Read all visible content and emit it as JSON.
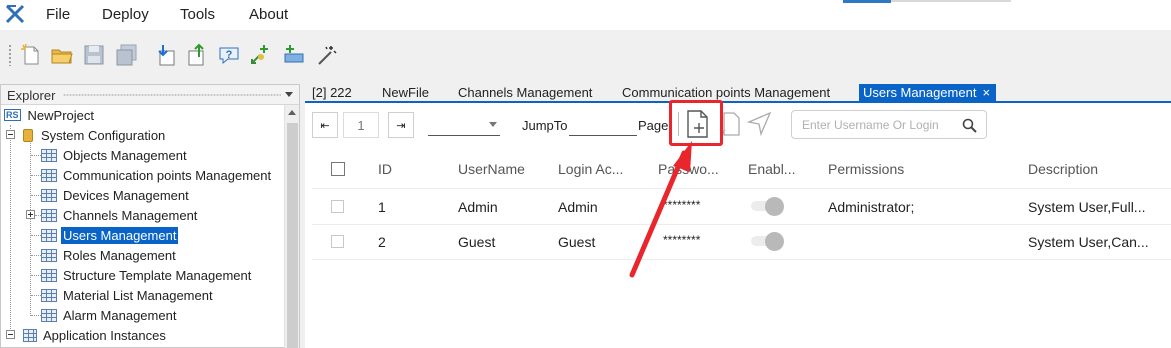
{
  "menu": [
    "File",
    "Deploy",
    "Tools",
    "About"
  ],
  "colors": {
    "accent": "#0a64c8",
    "highlight": "#e8262b"
  },
  "toolbar_icons": [
    "new-file-icon",
    "open-folder-icon",
    "save-icon",
    "save-all-icon",
    "import-icon",
    "export-icon",
    "help-icon",
    "add-device-icon",
    "add-item-icon",
    "magic-wand-icon"
  ],
  "explorer": {
    "title": "Explorer",
    "project_badge": "RS",
    "project": "NewProject",
    "system_config": "System Configuration",
    "items": [
      "Objects Management",
      "Communication points Management",
      "Devices Management",
      "Channels Management",
      "Users Management",
      "Roles Management",
      "Structure Template Management",
      "Material List Management",
      "Alarm Management"
    ],
    "app_instances": "Application Instances"
  },
  "tabs": [
    "[2] 222",
    "NewFile",
    "Channels Management",
    "Communication points Management",
    "Users Management"
  ],
  "tab_close": "×",
  "pager": {
    "first": "⇤",
    "page": "1",
    "last": "⇥",
    "jump_label": "JumpTo",
    "page_label": "Page"
  },
  "search": {
    "placeholder": "Enter Username Or Login"
  },
  "table": {
    "headers": [
      "ID",
      "UserName",
      "Login Ac...",
      "Passwo...",
      "Enabl...",
      "Permissions",
      "Description"
    ],
    "rows": [
      {
        "id": "1",
        "username": "Admin",
        "login": "Admin",
        "password": "********",
        "enabled": false,
        "permissions": "Administrator;",
        "description": "System User,Full..."
      },
      {
        "id": "2",
        "username": "Guest",
        "login": "Guest",
        "password": "********",
        "enabled": false,
        "permissions": "",
        "description": "System User,Can..."
      }
    ]
  }
}
